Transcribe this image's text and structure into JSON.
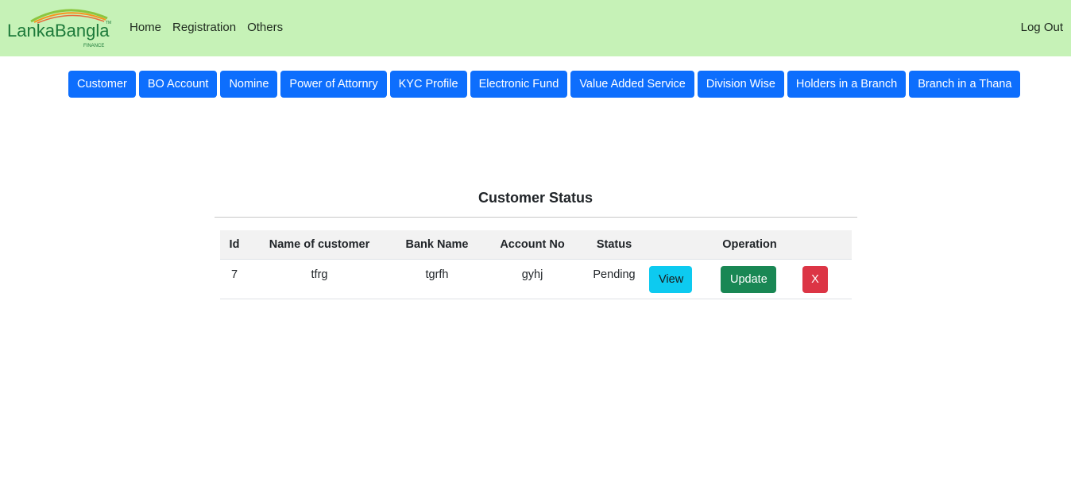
{
  "header": {
    "logo_text": "LankaBangla",
    "logo_subtext": "FINANCE",
    "logo_tm": "TM",
    "nav": [
      "Home",
      "Registration",
      "Others"
    ],
    "logout_label": "Log Out"
  },
  "tabs": [
    "Customer",
    "BO Account",
    "Nomine",
    "Power of Attornry",
    "KYC Profile",
    "Electronic Fund",
    "Value Added Service",
    "Division Wise",
    "Holders in a Branch",
    "Branch in a Thana"
  ],
  "main": {
    "title": "Customer Status",
    "table": {
      "columns": [
        "Id",
        "Name of customer",
        "Bank Name",
        "Account No",
        "Status",
        "Operation"
      ],
      "rows": [
        {
          "id": "7",
          "name": "tfrg",
          "bank": "tgrfh",
          "account": "gyhj",
          "status": "Pending"
        }
      ],
      "actions": {
        "view": "View",
        "update": "Update",
        "delete": "X"
      }
    }
  },
  "colors": {
    "navbar_bg": "#c6f2b7",
    "primary": "#0d6efd",
    "info": "#0dcaf0",
    "success": "#198754",
    "danger": "#dc3545"
  }
}
